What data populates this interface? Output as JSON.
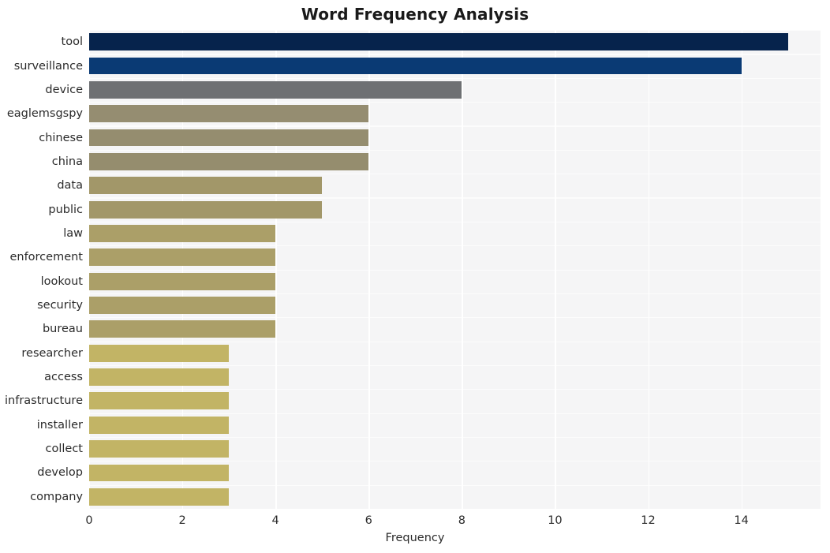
{
  "chart_data": {
    "type": "bar",
    "orientation": "horizontal",
    "title": "Word Frequency Analysis",
    "xlabel": "Frequency",
    "ylabel": "",
    "xlim": [
      0,
      15.7
    ],
    "xticks": [
      0,
      2,
      4,
      6,
      8,
      10,
      12,
      14
    ],
    "grid": true,
    "legend": null,
    "categories": [
      "tool",
      "surveillance",
      "device",
      "eaglemsgspy",
      "chinese",
      "china",
      "data",
      "public",
      "law",
      "enforcement",
      "lookout",
      "security",
      "bureau",
      "researcher",
      "access",
      "infrastructure",
      "installer",
      "collect",
      "develop",
      "company"
    ],
    "values": [
      15,
      14,
      8,
      6,
      6,
      6,
      5,
      5,
      4,
      4,
      4,
      4,
      4,
      3,
      3,
      3,
      3,
      3,
      3,
      3
    ],
    "bar_colors": [
      "#06234c",
      "#0a3a74",
      "#6e7073",
      "#958d71",
      "#958d6f",
      "#958d6e",
      "#a29769",
      "#a29769",
      "#ab9f68",
      "#ab9f68",
      "#ab9f68",
      "#ab9f68",
      "#ab9f68",
      "#c2b465",
      "#c2b465",
      "#c2b465",
      "#c2b465",
      "#c2b465",
      "#c2b465",
      "#c2b465"
    ],
    "plot_background": "#f5f5f6",
    "gridline_color": "#ffffff",
    "title_color": "#1a1a1a",
    "tick_color": "#2b2b2b"
  }
}
